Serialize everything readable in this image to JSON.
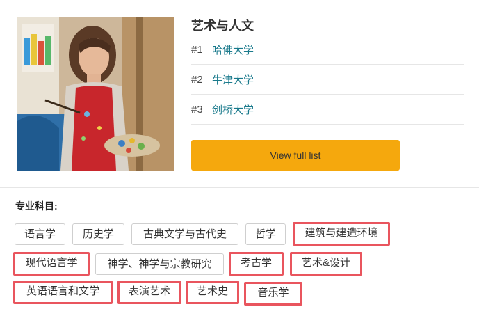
{
  "category": {
    "title": "艺术与人文",
    "rankings": [
      {
        "num": "#1",
        "name": "哈佛大学"
      },
      {
        "num": "#2",
        "name": "牛津大学"
      },
      {
        "num": "#3",
        "name": "剑桥大学"
      }
    ],
    "view_full_list": "View full list"
  },
  "subjects": {
    "heading": "专业科目:",
    "tags": [
      {
        "label": "语言学",
        "highlighted": false
      },
      {
        "label": "历史学",
        "highlighted": false
      },
      {
        "label": "古典文学与古代史",
        "highlighted": false
      },
      {
        "label": "哲学",
        "highlighted": false
      },
      {
        "label": "建筑与建造环境",
        "highlighted": true
      },
      {
        "label": "现代语言学",
        "highlighted": true
      },
      {
        "label": "神学、神学与宗教研究",
        "highlighted": false
      },
      {
        "label": "考古学",
        "highlighted": true
      },
      {
        "label": "艺术&设计",
        "highlighted": true
      },
      {
        "label": "英语语言和文学",
        "highlighted": true
      },
      {
        "label": "表演艺术",
        "highlighted": true
      },
      {
        "label": "艺术史",
        "highlighted": true
      },
      {
        "label": "音乐学",
        "highlighted": true
      }
    ]
  },
  "colors": {
    "accent_button": "#f5a80d",
    "link": "#1a7a8c",
    "highlight_border": "#e9555e"
  }
}
